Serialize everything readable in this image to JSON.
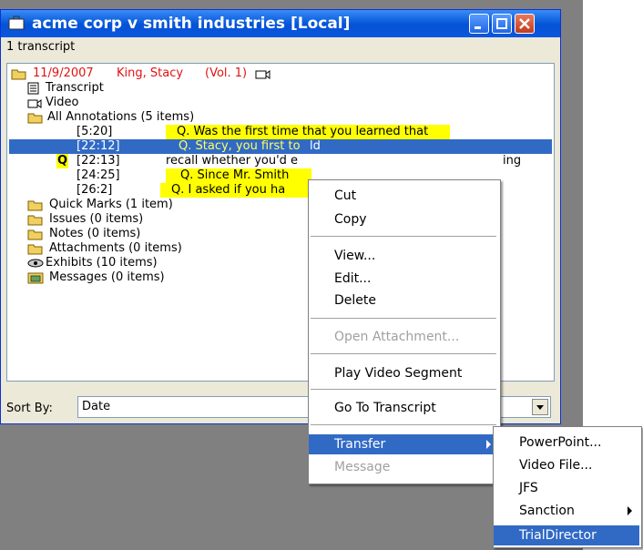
{
  "window": {
    "title": "acme corp v smith industries [Local]",
    "status": "1 transcript"
  },
  "tree": {
    "root": {
      "date": "11/9/2007",
      "name": "King, Stacy",
      "vol": "(Vol. 1)"
    },
    "items": [
      {
        "label": "Transcript"
      },
      {
        "label": "Video"
      },
      {
        "label": "All Annotations (5 items)"
      }
    ],
    "annotations": [
      {
        "time": "[5:20]",
        "text": "Q.   Was the first time that you learned that"
      },
      {
        "time": "[22:12]",
        "text": "Q.   Stacy, you first to",
        "tail": "ld"
      },
      {
        "time": "[22:13]",
        "text": "recall whether you'd e",
        "tail": "ing"
      },
      {
        "time": "[24:25]",
        "text": "Q.   Since Mr. Smith"
      },
      {
        "time": "[26:2]",
        "text": "Q.   I asked if you ha"
      }
    ],
    "folders": [
      {
        "label": "Quick Marks (1 item)"
      },
      {
        "label": "Issues (0 items)"
      },
      {
        "label": "Notes (0 items)"
      },
      {
        "label": "Attachments (0 items)"
      },
      {
        "label": "Exhibits (10 items)"
      },
      {
        "label": "Messages (0 items)"
      }
    ]
  },
  "sort": {
    "label": "Sort By:",
    "value": "Date"
  },
  "context_menu": {
    "items": [
      {
        "label": "Cut"
      },
      {
        "label": "Copy"
      },
      {
        "label": "View..."
      },
      {
        "label": "Edit..."
      },
      {
        "label": "Delete"
      },
      {
        "label": "Open Attachment..."
      },
      {
        "label": "Play Video Segment"
      },
      {
        "label": "Go To Transcript"
      },
      {
        "label": "Transfer"
      },
      {
        "label": "Message"
      }
    ]
  },
  "submenu": {
    "items": [
      {
        "label": "PowerPoint..."
      },
      {
        "label": "Video File..."
      },
      {
        "label": "JFS"
      },
      {
        "label": "Sanction"
      },
      {
        "label": "TrialDirector"
      }
    ]
  },
  "colors": {
    "selection": "#316ac5",
    "highlight": "#ffff00",
    "root_text": "#e21212",
    "titlebar": "#0a5cdc"
  }
}
